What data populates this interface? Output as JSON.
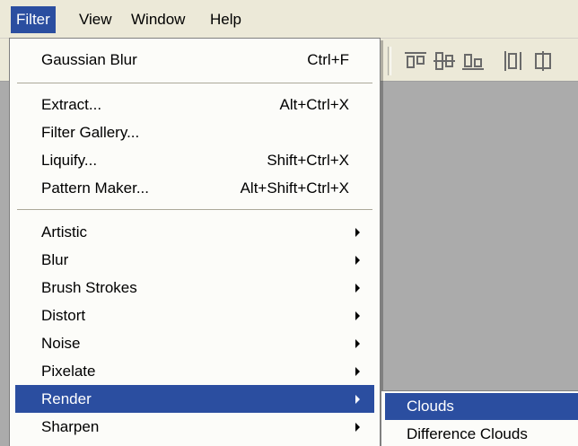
{
  "menubar": {
    "items": [
      {
        "label": "Filter",
        "active": true
      },
      {
        "label": "View",
        "active": false
      },
      {
        "label": "Window",
        "active": false
      },
      {
        "label": "Help",
        "active": false
      }
    ]
  },
  "toolbar": {
    "icons": [
      "align-top-icon",
      "align-vertical-center-icon",
      "align-bottom-icon",
      "align-left-icon"
    ]
  },
  "filter_menu": {
    "items": [
      {
        "label": "Gaussian Blur",
        "shortcut": "Ctrl+F"
      },
      {
        "label": "Extract...",
        "shortcut": "Alt+Ctrl+X"
      },
      {
        "label": "Filter Gallery...",
        "shortcut": ""
      },
      {
        "label": "Liquify...",
        "shortcut": "Shift+Ctrl+X"
      },
      {
        "label": "Pattern Maker...",
        "shortcut": "Alt+Shift+Ctrl+X"
      },
      {
        "label": "Artistic",
        "submenu": true
      },
      {
        "label": "Blur",
        "submenu": true
      },
      {
        "label": "Brush Strokes",
        "submenu": true
      },
      {
        "label": "Distort",
        "submenu": true
      },
      {
        "label": "Noise",
        "submenu": true
      },
      {
        "label": "Pixelate",
        "submenu": true
      },
      {
        "label": "Render",
        "submenu": true,
        "highlighted": true
      },
      {
        "label": "Sharpen",
        "submenu": true
      }
    ]
  },
  "render_submenu": {
    "items": [
      {
        "label": "Clouds",
        "highlighted": true
      },
      {
        "label": "Difference Clouds"
      }
    ]
  },
  "colors": {
    "highlight": "#2b4ea0",
    "menu_bg": "#fcfcf9",
    "workspace": "#ababab",
    "bar_bg": "#ece9d8"
  }
}
